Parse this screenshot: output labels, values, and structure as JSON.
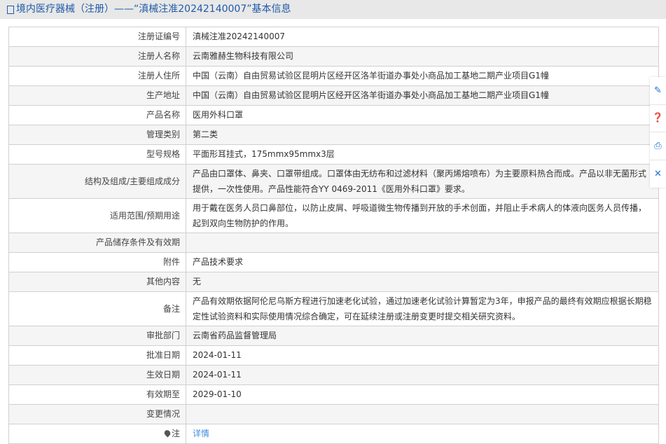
{
  "header": {
    "title": "境内医疗器械（注册）——“滇械注准20242140007”基本信息"
  },
  "rows": [
    {
      "label": "注册证编号",
      "value": "滇械注准20242140007"
    },
    {
      "label": "注册人名称",
      "value": "云南雅赫生物科技有限公司"
    },
    {
      "label": "注册人住所",
      "value": "中国（云南）自由贸易试验区昆明片区经开区洛羊街道办事处小商品加工基地二期产业项目G1幢"
    },
    {
      "label": "生产地址",
      "value": "中国（云南）自由贸易试验区昆明片区经开区洛羊街道办事处小商品加工基地二期产业项目G1幢"
    },
    {
      "label": "产品名称",
      "value": "医用外科口罩"
    },
    {
      "label": "管理类别",
      "value": "第二类"
    },
    {
      "label": "型号规格",
      "value": "平面形耳挂式，175mmx95mmx3层"
    },
    {
      "label": "结构及组成/主要组成成分",
      "value": "产品由口罩体、鼻夹、口罩带组成。口罩体由无纺布和过滤材料（聚丙烯熔喷布）为主要原料热合而成。产品以非无菌形式提供，一次性使用。产品性能符合YY 0469-2011《医用外科口罩》要求。"
    },
    {
      "label": "适用范围/预期用途",
      "value": "用于戴在医务人员口鼻部位，以防止皮屑、呼吸道微生物传播到开放的手术创面，并阻止手术病人的体液向医务人员传播，起到双向生物防护的作用。"
    },
    {
      "label": "产品储存条件及有效期",
      "value": ""
    },
    {
      "label": "附件",
      "value": "产品技术要求"
    },
    {
      "label": "其他内容",
      "value": "无"
    },
    {
      "label": "备注",
      "value": "产品有效期依据阿伦尼乌斯方程进行加速老化试验，通过加速老化试验计算暂定为3年，申报产品的最终有效期应根据长期稳定性试验资料和实际使用情况综合确定，可在延续注册或注册变更时提交相关研究资料。"
    },
    {
      "label": "审批部门",
      "value": "云南省药品监督管理局"
    },
    {
      "label": "批准日期",
      "value": "2024-01-11"
    },
    {
      "label": "生效日期",
      "value": "2024-01-11"
    },
    {
      "label": "有效期至",
      "value": "2029-01-10"
    },
    {
      "label": "变更情况",
      "value": ""
    }
  ],
  "note": {
    "label": "注",
    "link": "详情"
  },
  "side_icons": [
    "edit-icon",
    "help-icon",
    "print-icon",
    "close-icon"
  ],
  "colors": {
    "title": "#1f5aa8",
    "link": "#3f8de0"
  }
}
